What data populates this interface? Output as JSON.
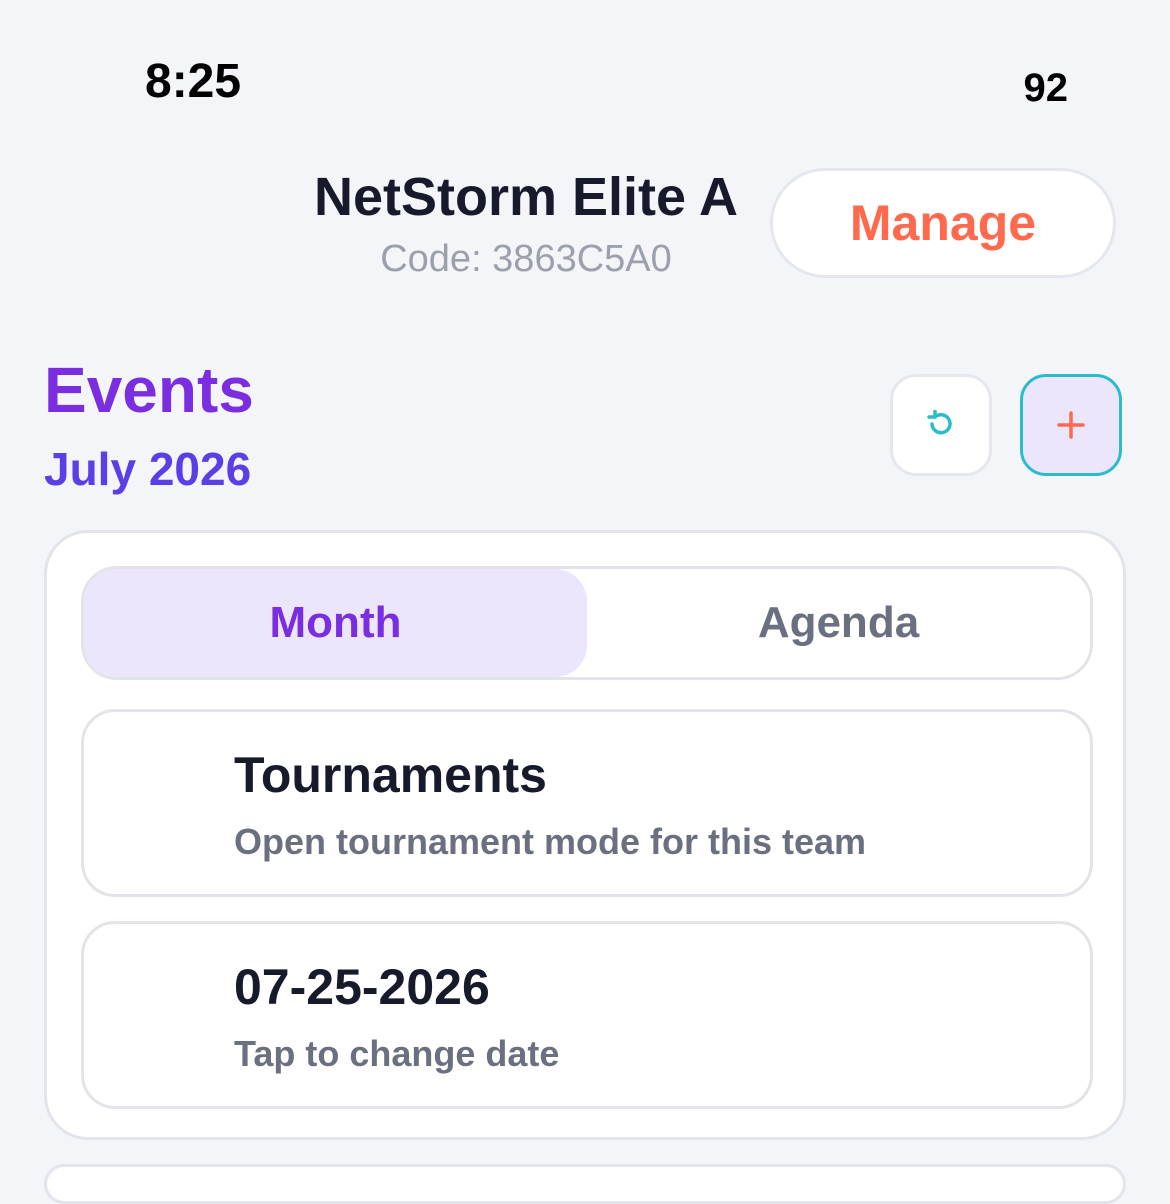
{
  "status_bar": {
    "time": "8:25",
    "battery": "92"
  },
  "header": {
    "team_name": "NetStorm Elite A",
    "team_code": "Code: 3863C5A0",
    "manage_label": "Manage"
  },
  "events": {
    "title": "Events",
    "month_label": "July 2026",
    "refresh_icon": "refresh-icon",
    "add_icon": "plus-icon"
  },
  "view_tabs": {
    "items": [
      {
        "label": "Month",
        "selected": true
      },
      {
        "label": "Agenda",
        "selected": false
      }
    ]
  },
  "tournaments": {
    "title": "Tournaments",
    "subtitle": "Open tournament mode for this team"
  },
  "date_picker": {
    "value": "07-25-2026",
    "hint": "Tap to change date"
  },
  "colors": {
    "accent_purple": "#7a2ee0",
    "accent_coral": "#ff6a4f",
    "accent_teal": "#2bbccc",
    "background": "#f4f5f9"
  }
}
